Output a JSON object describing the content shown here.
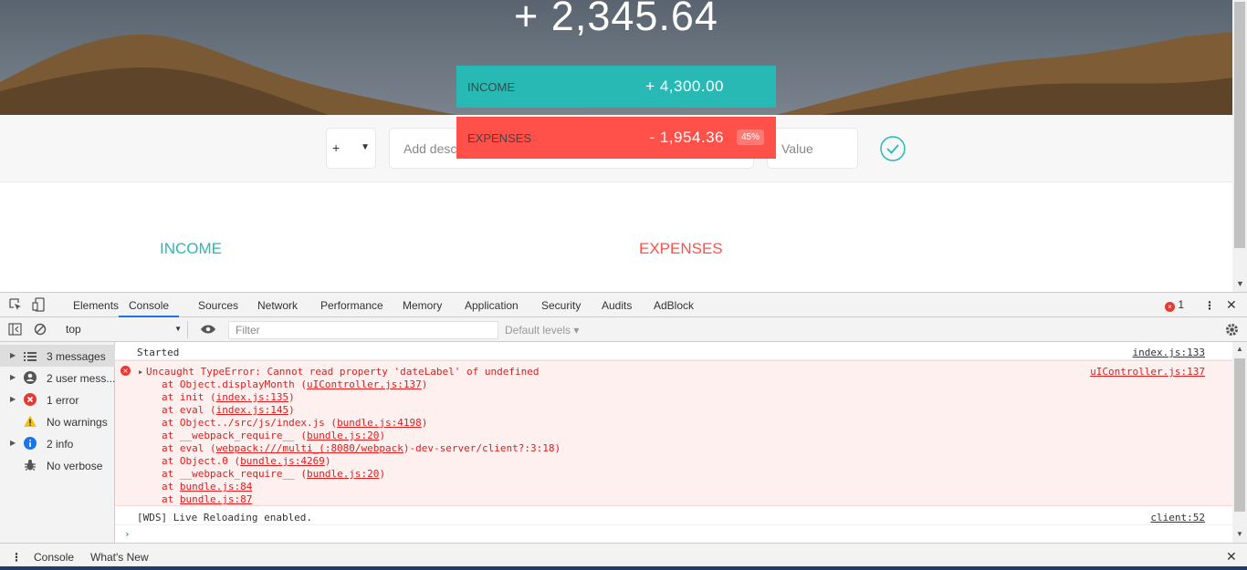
{
  "app": {
    "budget_value": "+ 2,345.64",
    "income": {
      "label": "Income",
      "value": "+ 4,300.00"
    },
    "expenses": {
      "label": "Expenses",
      "value": "- 1,954.36",
      "percentage": "45%"
    },
    "add_form": {
      "type_value": "+",
      "description_placeholder": "Add description",
      "value_placeholder": "Value"
    },
    "lists": {
      "income_title": "INCOME",
      "expenses_title": "EXPENSES"
    },
    "colors": {
      "income": "#28b9b5",
      "expenses": "#ff5049"
    }
  },
  "devtools": {
    "tabs": [
      "Elements",
      "Console",
      "Sources",
      "Network",
      "Performance",
      "Memory",
      "Application",
      "Security",
      "Audits",
      "AdBlock"
    ],
    "error_count": "1",
    "context": "top",
    "filter_placeholder": "Filter",
    "levels": "Default levels ▾",
    "sidebar": [
      {
        "label": "3 messages"
      },
      {
        "label": "2 user mess..."
      },
      {
        "label": "1 error"
      },
      {
        "label": "No warnings"
      },
      {
        "label": "2 info"
      },
      {
        "label": "No verbose"
      }
    ],
    "console": {
      "started": {
        "text": "Started",
        "source": "index.js:133"
      },
      "error": {
        "message": "Uncaught TypeError: Cannot read property 'dateLabel' of undefined",
        "source": "uIController.js:137",
        "stack": [
          {
            "pre": "at Object.displayMonth (",
            "link": "uIController.js:137",
            "post": ")"
          },
          {
            "pre": "at init (",
            "link": "index.js:135",
            "post": ")"
          },
          {
            "pre": "at eval (",
            "link": "index.js:145",
            "post": ")"
          },
          {
            "pre": "at Object../src/js/index.js (",
            "link": "bundle.js:4198",
            "post": ")"
          },
          {
            "pre": "at __webpack_require__ (",
            "link": "bundle.js:20",
            "post": ")"
          },
          {
            "pre": "at eval (",
            "link": "webpack:///multi_(:8080/webpack",
            "post": ")-dev-server/client?:3:18)"
          },
          {
            "pre": "at Object.0 (",
            "link": "bundle.js:4269",
            "post": ")"
          },
          {
            "pre": "at __webpack_require__ (",
            "link": "bundle.js:20",
            "post": ")"
          },
          {
            "pre": "at ",
            "link": "bundle.js:84",
            "post": ""
          },
          {
            "pre": "at ",
            "link": "bundle.js:87",
            "post": ""
          }
        ]
      },
      "wds": {
        "text": "[WDS] Live Reloading enabled.",
        "source": "client:52"
      }
    },
    "drawer_tabs": [
      "Console",
      "What's New"
    ]
  }
}
